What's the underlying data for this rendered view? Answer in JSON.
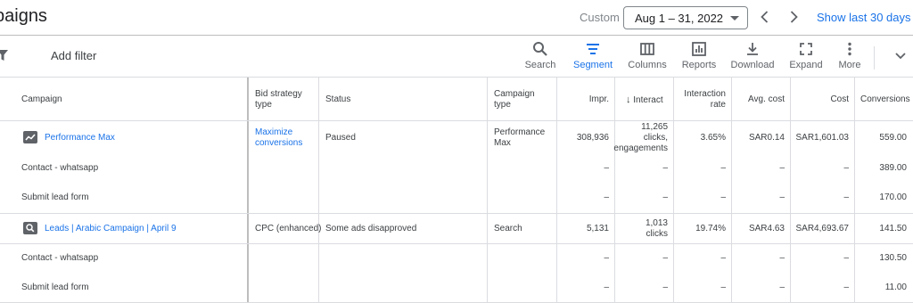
{
  "header": {
    "title": "paigns",
    "custom_label": "Custom",
    "date_range": "Aug 1 – 31, 2022",
    "show_last": "Show last 30 days"
  },
  "toolbar": {
    "add_filter": "Add filter",
    "tools": {
      "search": "Search",
      "segment": "Segment",
      "columns": "Columns",
      "reports": "Reports",
      "download": "Download",
      "expand": "Expand",
      "more": "More"
    },
    "accent_color": "#1a73e8"
  },
  "table": {
    "columns": {
      "campaign": "Campaign",
      "bid_strategy": [
        "Bid strategy",
        "type"
      ],
      "status": "Status",
      "campaign_type": [
        "Campaign",
        "type"
      ],
      "impr": "Impr.",
      "interactions": "Interact",
      "interaction_rate": [
        "Interaction",
        "rate"
      ],
      "avg_cost": "Avg. cost",
      "cost": "Cost",
      "conversions": "Conversions"
    },
    "rows": [
      {
        "campaign": "Performance Max",
        "bid_strategy": [
          "Maximize",
          "conversions"
        ],
        "status": "Paused",
        "campaign_type": [
          "Performance",
          "Max"
        ],
        "impr": "308,936",
        "interactions": [
          "11,265",
          "clicks,",
          "engagements"
        ],
        "interaction_rate": "3.65%",
        "avg_cost": "SAR0.14",
        "cost": "SAR1,601.03",
        "conversions": "559.00"
      },
      {
        "campaign": "Contact - whatsapp",
        "impr": "–",
        "interactions": "–",
        "interaction_rate": "–",
        "avg_cost": "–",
        "cost": "–",
        "conversions": "389.00"
      },
      {
        "campaign": "Submit lead form",
        "impr": "–",
        "interactions": "–",
        "interaction_rate": "–",
        "avg_cost": "–",
        "cost": "–",
        "conversions": "170.00"
      },
      {
        "campaign": "Leads | Arabic Campaign | April 9",
        "bid_strategy": "CPC (enhanced)",
        "status": "Some ads disapproved",
        "campaign_type": "Search",
        "impr": "5,131",
        "interactions": [
          "1,013",
          "clicks"
        ],
        "interaction_rate": "19.74%",
        "avg_cost": "SAR4.63",
        "cost": "SAR4,693.67",
        "conversions": "141.50"
      },
      {
        "campaign": "Contact - whatsapp",
        "impr": "–",
        "interactions": "–",
        "interaction_rate": "–",
        "avg_cost": "–",
        "cost": "–",
        "conversions": "130.50"
      },
      {
        "campaign": "Submit lead form",
        "impr": "–",
        "interactions": "–",
        "interaction_rate": "–",
        "avg_cost": "–",
        "cost": "–",
        "conversions": "11.00"
      }
    ]
  }
}
